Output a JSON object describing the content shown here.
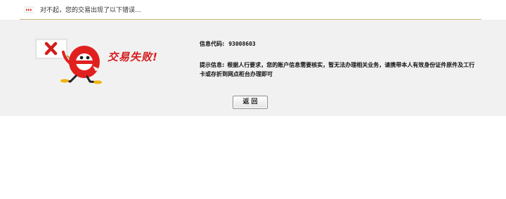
{
  "header": {
    "message": "对不起，您的交易出现了以下错误...",
    "icon": "arrow-indicator-icon"
  },
  "illustration": {
    "title": "交易失败!",
    "icon": "error-x-sign-icon",
    "mascot": "e-mascot-icon",
    "accent_color": "#d61c1c"
  },
  "info": {
    "code_label": "信息代码:",
    "code_value": "93008603",
    "tip_label": "提示信息:",
    "tip_line1": "根据人行要求，您的账户信息需要核实，暂无法办理相关业务，请携带本人有效身份证件原件及工行",
    "tip_line2": "卡或存折到网点柜台办理即可"
  },
  "actions": {
    "back_label": "返回"
  }
}
